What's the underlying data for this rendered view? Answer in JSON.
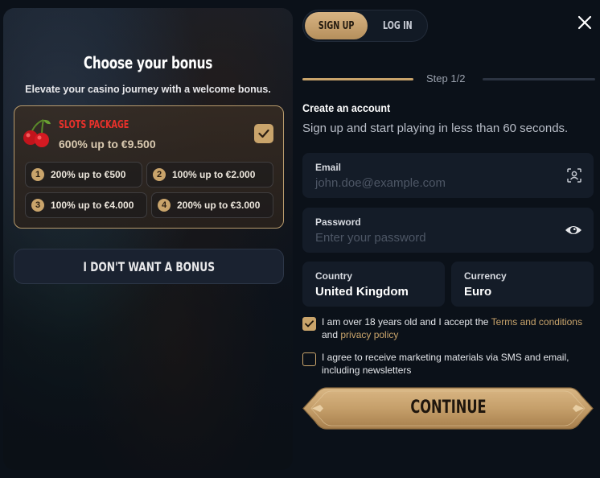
{
  "bonus_panel": {
    "title": "Choose your bonus",
    "subtitle": "Elevate your casino journey with a welcome bonus.",
    "package": {
      "name": "SLOTS PACKAGE",
      "description": "600% up to €9.500",
      "selected": true,
      "icon": "cherries-icon"
    },
    "tiers": [
      {
        "number": "1",
        "label": "200% up to €500"
      },
      {
        "number": "2",
        "label": "100% up to €2.000"
      },
      {
        "number": "3",
        "label": "100% up to €4.000"
      },
      {
        "number": "4",
        "label": "200% up to €3.000"
      }
    ],
    "no_bonus_label": "I DON'T WANT A BONUS"
  },
  "tabs": {
    "signup": "SIGN UP",
    "login": "LOG IN",
    "active": "signup"
  },
  "close_icon": "close-icon",
  "step": {
    "label": "Step 1/2",
    "current": 1,
    "total": 2
  },
  "form": {
    "title": "Create an account",
    "subtitle": "Sign up and start playing in less than 60 seconds.",
    "email": {
      "label": "Email",
      "placeholder": "john.doe@example.com"
    },
    "password": {
      "label": "Password",
      "placeholder": "Enter your password"
    },
    "country": {
      "label": "Country",
      "value": "United Kingdom"
    },
    "currency": {
      "label": "Currency",
      "value": "Euro"
    },
    "terms": {
      "checked": true,
      "text_before": "I am over 18 years old and I accept the ",
      "terms_link": "Terms and conditions",
      "text_and": " and ",
      "privacy_link": "privacy policy"
    },
    "marketing": {
      "checked": false,
      "text": "I agree to receive marketing materials via SMS and email, including newsletters"
    },
    "continue_label": "CONTINUE"
  },
  "colors": {
    "accent_gold": "#c9a46b",
    "background": "#0b1119",
    "field_bg": "#141c28",
    "package_red": "#e8312b"
  }
}
